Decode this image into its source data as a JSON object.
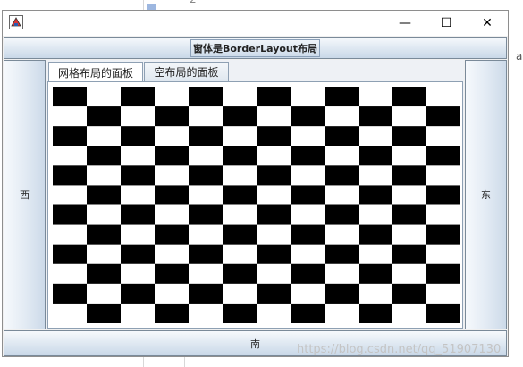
{
  "window": {
    "minimize_glyph": "—",
    "maximize_glyph": "☐",
    "close_glyph": "✕"
  },
  "north": {
    "label": "窗体是BorderLayout布局"
  },
  "west": {
    "label": "西"
  },
  "east": {
    "label": "东"
  },
  "south": {
    "label": "南"
  },
  "tabs": [
    {
      "label": "网格布局的面板",
      "selected": true
    },
    {
      "label": "空布局的面板",
      "selected": false
    }
  ],
  "checkerboard": {
    "rows": 12,
    "cols": 12,
    "colors": [
      "#000000",
      "#ffffff"
    ]
  },
  "background": {
    "right_letter": "a",
    "top_char": "2"
  },
  "watermark": "https://blog.csdn.net/qq_51907130"
}
